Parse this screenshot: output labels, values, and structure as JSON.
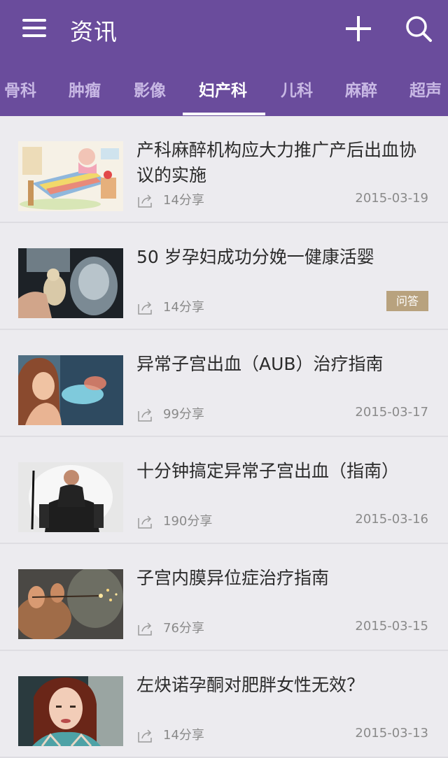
{
  "header": {
    "title": "资讯",
    "icons": [
      "menu-icon",
      "plus-icon",
      "search-icon"
    ],
    "color": "#6a4c9c"
  },
  "tabs": [
    {
      "label": "骨科",
      "active": false
    },
    {
      "label": "肿瘤",
      "active": false
    },
    {
      "label": "影像",
      "active": false
    },
    {
      "label": "妇产科",
      "active": true
    },
    {
      "label": "儿科",
      "active": false
    },
    {
      "label": "麻醉",
      "active": false
    },
    {
      "label": "超声",
      "active": false
    }
  ],
  "articles": [
    {
      "title": "产科麻醉机构应大力推广产后出血协议的实施",
      "shares": "14分享",
      "date": "2015-03-19",
      "badge": ""
    },
    {
      "title": "50 岁孕妇成功分娩一健康活婴",
      "shares": "14分享",
      "date": "",
      "badge": "问答"
    },
    {
      "title": "异常子宫出血（AUB）治疗指南",
      "shares": "99分享",
      "date": "2015-03-17",
      "badge": ""
    },
    {
      "title": "十分钟搞定异常子宫出血（指南）",
      "shares": "190分享",
      "date": "2015-03-16",
      "badge": ""
    },
    {
      "title": "子宫内膜异位症治疗指南",
      "shares": "76分享",
      "date": "2015-03-15",
      "badge": ""
    },
    {
      "title": "左炔诺孕酮对肥胖女性无效？",
      "shares": "14分享",
      "date": "2015-03-13",
      "badge": ""
    }
  ]
}
